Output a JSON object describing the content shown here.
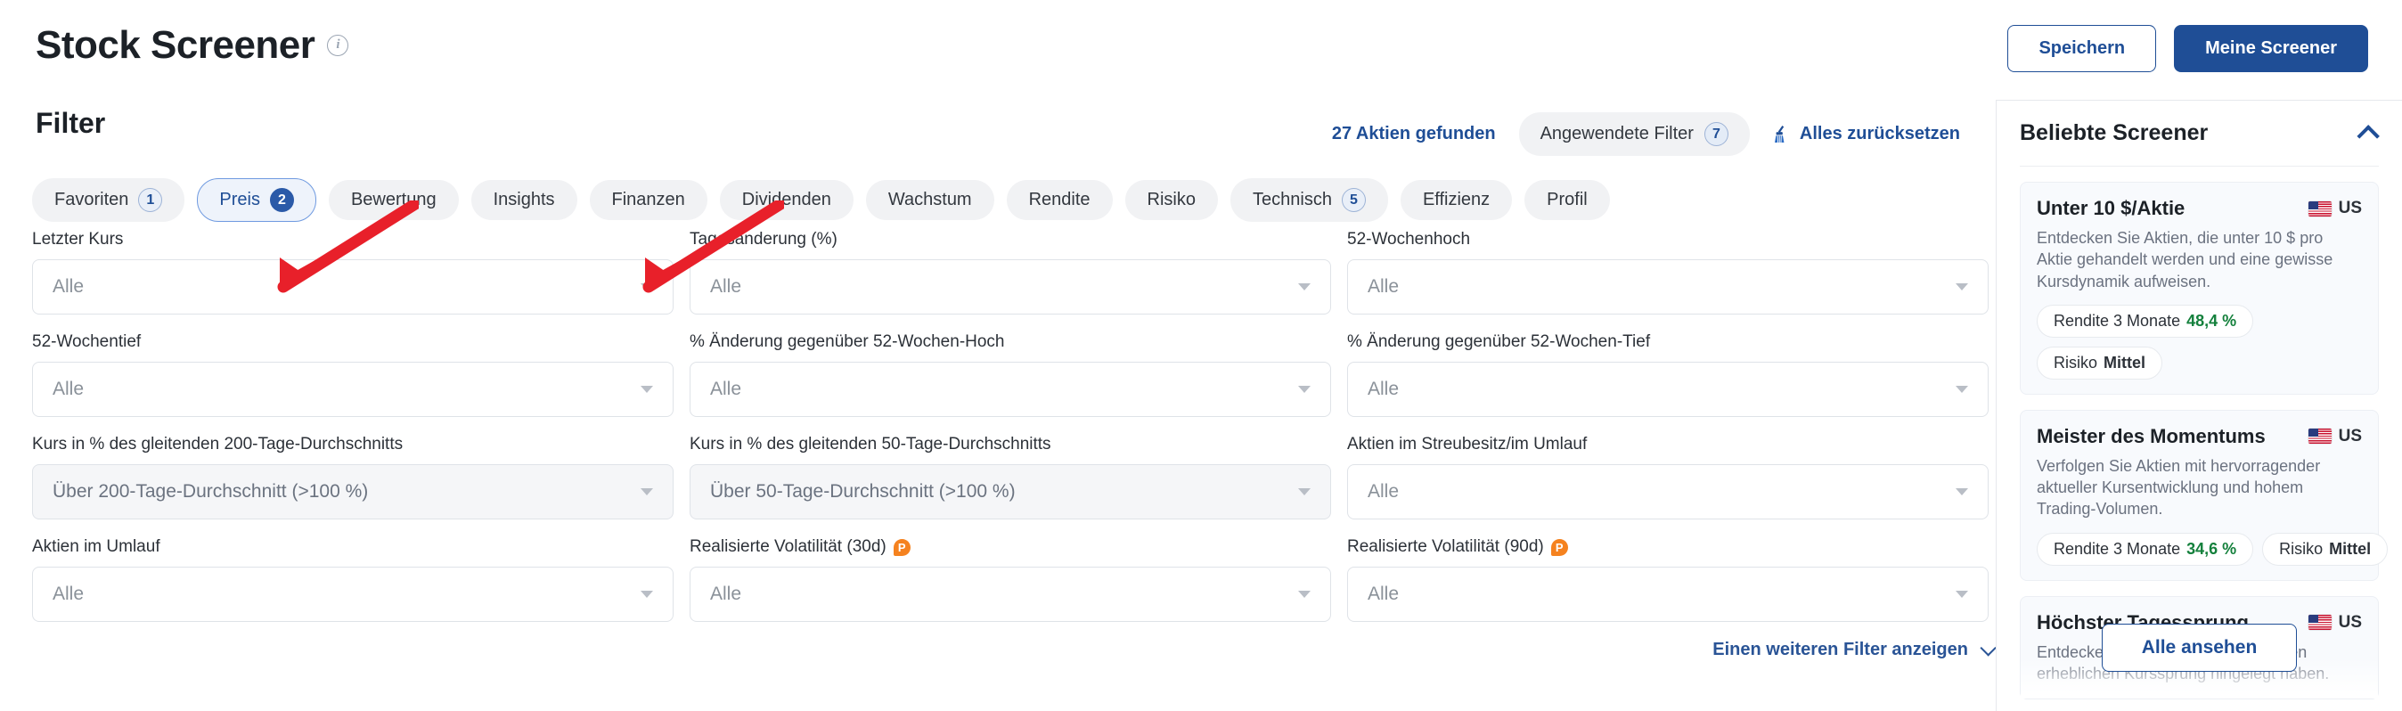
{
  "header": {
    "title": "Stock Screener",
    "info_icon": "info-icon",
    "save_label": "Speichern",
    "my_screeners_label": "Meine Screener"
  },
  "filter_bar": {
    "title": "Filter",
    "found_count": "27 Aktien gefunden",
    "applied_filters_label": "Angewendete Filter",
    "applied_filters_count": "7",
    "reset_label": "Alles zurücksetzen",
    "reset_icon": "broom-icon"
  },
  "tabs": [
    {
      "label": "Favoriten",
      "count": "1",
      "active": false
    },
    {
      "label": "Preis",
      "count": "2",
      "active": true
    },
    {
      "label": "Bewertung",
      "count": "",
      "active": false
    },
    {
      "label": "Insights",
      "count": "",
      "active": false
    },
    {
      "label": "Finanzen",
      "count": "",
      "active": false
    },
    {
      "label": "Dividenden",
      "count": "",
      "active": false
    },
    {
      "label": "Wachstum",
      "count": "",
      "active": false
    },
    {
      "label": "Rendite",
      "count": "",
      "active": false
    },
    {
      "label": "Risiko",
      "count": "",
      "active": false
    },
    {
      "label": "Technisch",
      "count": "5",
      "active": false
    },
    {
      "label": "Effizienz",
      "count": "",
      "active": false
    },
    {
      "label": "Profil",
      "count": "",
      "active": false
    }
  ],
  "filters": [
    {
      "label": "Letzter Kurs",
      "value": "Alle",
      "filled": false,
      "pro": false
    },
    {
      "label": "Tagesänderung (%)",
      "value": "Alle",
      "filled": false,
      "pro": false
    },
    {
      "label": "52-Wochenhoch",
      "value": "Alle",
      "filled": false,
      "pro": false
    },
    {
      "label": "52-Wochentief",
      "value": "Alle",
      "filled": false,
      "pro": false
    },
    {
      "label": "% Änderung gegenüber 52-Wochen-Hoch",
      "value": "Alle",
      "filled": false,
      "pro": false
    },
    {
      "label": "% Änderung gegenüber 52-Wochen-Tief",
      "value": "Alle",
      "filled": false,
      "pro": false
    },
    {
      "label": "Kurs in % des gleitenden 200-Tage-Durchschnitts",
      "value": "Über 200-Tage-Durchschnitt (>100 %)",
      "filled": true,
      "pro": false
    },
    {
      "label": "Kurs in % des gleitenden 50-Tage-Durchschnitts",
      "value": "Über 50-Tage-Durchschnitt (>100 %)",
      "filled": true,
      "pro": false
    },
    {
      "label": "Aktien im Streubesitz/im Umlauf",
      "value": "Alle",
      "filled": false,
      "pro": false
    },
    {
      "label": "Aktien im Umlauf",
      "value": "Alle",
      "filled": false,
      "pro": false
    },
    {
      "label": "Realisierte Volatilität (30d)",
      "value": "Alle",
      "filled": false,
      "pro": true
    },
    {
      "label": "Realisierte Volatilität (90d)",
      "value": "Alle",
      "filled": false,
      "pro": true
    }
  ],
  "more_filters_label": "Einen weiteren Filter anzeigen",
  "sidebar": {
    "title": "Beliebte Screener",
    "collapse_icon": "chevron-up-icon",
    "view_all_label": "Alle ansehen",
    "screeners": [
      {
        "name": "Unter 10 $/Aktie",
        "region": "US",
        "region_icon": "us-flag-icon",
        "description": "Entdecken Sie Aktien, die unter 10 $ pro Aktie gehandelt werden und eine gewisse Kursdynamik aufweisen.",
        "chips": [
          {
            "label": "Rendite 3 Monate",
            "value": "48,4 %",
            "type": "positive"
          },
          {
            "label": "Risiko",
            "value": "Mittel",
            "type": "neutral"
          }
        ]
      },
      {
        "name": "Meister des Momentums",
        "region": "US",
        "region_icon": "us-flag-icon",
        "description": "Verfolgen Sie Aktien mit hervorragender aktueller Kursentwicklung und hohem Trading-Volumen.",
        "chips": [
          {
            "label": "Rendite 3 Monate",
            "value": "34,6 %",
            "type": "positive"
          },
          {
            "label": "Risiko",
            "value": "Mittel",
            "type": "neutral"
          }
        ]
      },
      {
        "name": "Höchster Tagessprung",
        "region": "US",
        "region_icon": "us-flag-icon",
        "description": "Entdecken Sie Aktien, die heute einen erheblichen Kurssprung hingelegt haben.",
        "chips": []
      }
    ]
  },
  "annotations": {
    "arrow_color": "#e8202a",
    "arrows": [
      {
        "name": "arrow-to-200-day-filter"
      },
      {
        "name": "arrow-to-50-day-filter"
      }
    ]
  },
  "colors": {
    "accent": "#1f4e96",
    "positive": "#14803c",
    "pro": "#f5821f",
    "tab_bg": "#f1f2f4"
  }
}
